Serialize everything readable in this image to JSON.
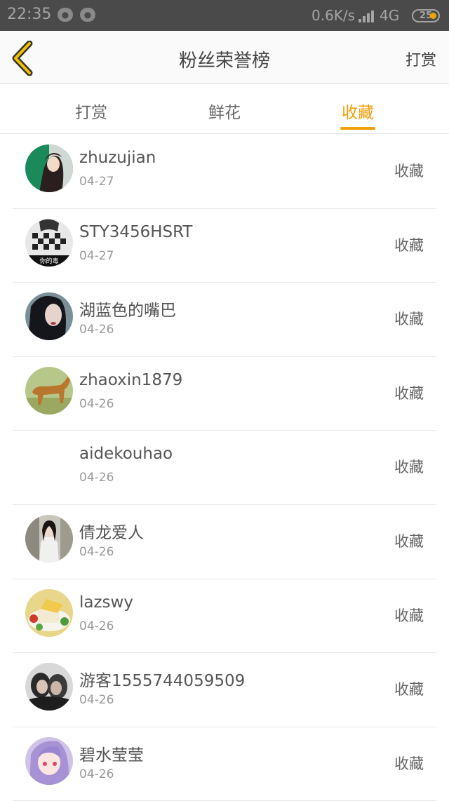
{
  "status": {
    "time": "22:35",
    "net_speed": "0.6K/s",
    "network": "4G",
    "battery": "25"
  },
  "header": {
    "title": "粉丝荣誉榜",
    "right_label": "打赏"
  },
  "tabs": [
    {
      "label": "打赏",
      "active": false
    },
    {
      "label": "鲜花",
      "active": false
    },
    {
      "label": "收藏",
      "active": true
    }
  ],
  "colors": {
    "accent": "#f0a00a"
  },
  "fans": [
    {
      "name": "zhuzujian",
      "date": "04-27",
      "action": "收藏",
      "avatar": "anime-man-avatar"
    },
    {
      "name": "STY3456HSRT",
      "date": "04-27",
      "action": "收藏",
      "avatar": "plaid-shirt-avatar"
    },
    {
      "name": "湖蓝色的嘴巴",
      "date": "04-26",
      "action": "收藏",
      "avatar": "dark-hair-woman-avatar"
    },
    {
      "name": "zhaoxin1879",
      "date": "04-26",
      "action": "收藏",
      "avatar": "dog-avatar"
    },
    {
      "name": "aidekouhao",
      "date": "04-26",
      "action": "收藏",
      "avatar": ""
    },
    {
      "name": "倩龙爱人",
      "date": "04-26",
      "action": "收藏",
      "avatar": "girl-street-avatar"
    },
    {
      "name": "lazswy",
      "date": "04-26",
      "action": "收藏",
      "avatar": "food-plate-avatar"
    },
    {
      "name": "游客1555744059509",
      "date": "04-26",
      "action": "收藏",
      "avatar": "couple-avatar"
    },
    {
      "name": "碧水莹莹",
      "date": "04-26",
      "action": "收藏",
      "avatar": "anime-girl-avatar"
    }
  ]
}
